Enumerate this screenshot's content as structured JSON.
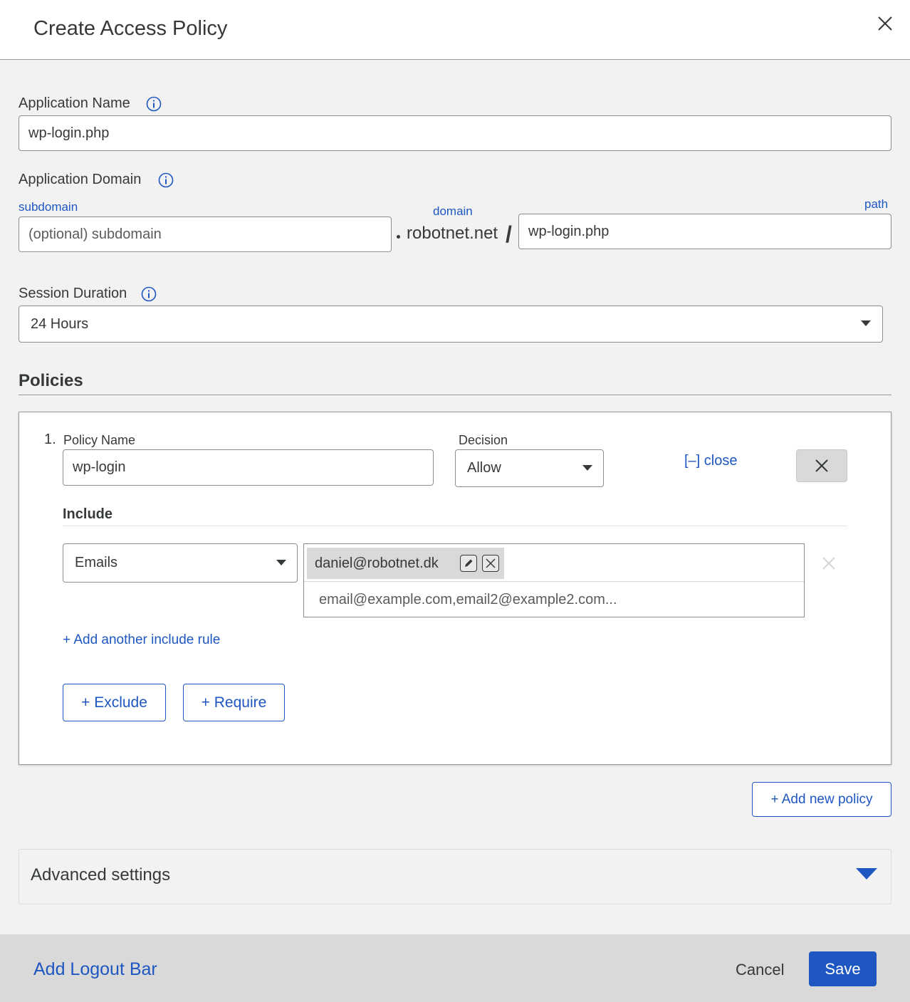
{
  "dialog": {
    "title": "Create Access Policy",
    "close_icon": "close-icon"
  },
  "application_name": {
    "label": "Application Name",
    "value": "wp-login.php"
  },
  "application_domain": {
    "label": "Application Domain",
    "subdomain_label": "subdomain",
    "subdomain_placeholder": "(optional) subdomain",
    "domain_label": "domain",
    "domain_value": "robotnet.net",
    "separator": "/",
    "path_label": "path",
    "path_value": "wp-login.php"
  },
  "session_duration": {
    "label": "Session Duration",
    "value": "24 Hours"
  },
  "policies": {
    "title": "Policies",
    "items": [
      {
        "number": "1.",
        "name_label": "Policy Name",
        "name_value": "wp-login",
        "decision_label": "Decision",
        "decision_value": "Allow",
        "close_link": "[–] close",
        "include_title": "Include",
        "include_rules": [
          {
            "selector": "Emails",
            "chips": [
              "daniel@robotnet.dk"
            ],
            "input_placeholder": "email@example.com,email2@example2.com..."
          }
        ],
        "add_include_link": "+ Add another include rule",
        "exclude_button": "+ Exclude",
        "require_button": "+ Require"
      }
    ],
    "add_policy_button": "+ Add new policy"
  },
  "advanced_settings": {
    "title": "Advanced settings"
  },
  "footer": {
    "logout_link": "Add Logout Bar",
    "cancel": "Cancel",
    "save": "Save"
  },
  "colors": {
    "accent": "#1e56c2",
    "text": "#36393a",
    "background": "#f2f2f2"
  }
}
